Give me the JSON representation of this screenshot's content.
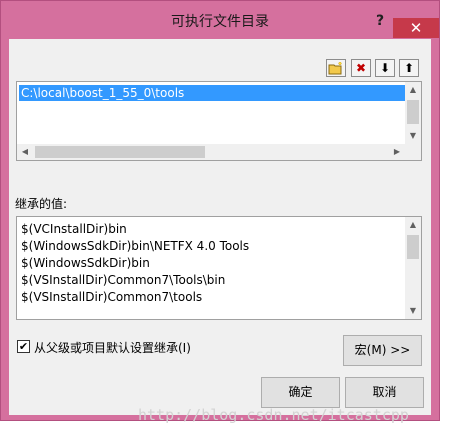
{
  "window": {
    "title": "可执行文件目录",
    "help_glyph": "?",
    "close_glyph": "✕"
  },
  "toolbar": {
    "new_line_icon": "new-folder-icon",
    "delete_glyph": "✖",
    "move_down_glyph": "⬇",
    "move_up_glyph": "⬆"
  },
  "directories": {
    "items": [
      "C:\\local\\boost_1_55_0\\tools"
    ],
    "selected_index": 0
  },
  "inherited": {
    "label": "继承的值:",
    "items": [
      "$(VCInstallDir)bin",
      "$(WindowsSdkDir)bin\\NETFX 4.0 Tools",
      "$(WindowsSdkDir)bin",
      "$(VSInstallDir)Common7\\Tools\\bin",
      "$(VSInstallDir)Common7\\tools"
    ]
  },
  "inherit_checkbox": {
    "label": "从父级或项目默认设置继承(I)",
    "checked": true,
    "check_glyph": "✔"
  },
  "buttons": {
    "macros": "宏(M) >>",
    "ok": "确定",
    "cancel": "取消"
  },
  "watermark": "http://blog.csdn.net/itcastcpp",
  "colors": {
    "frame": "#d5709e",
    "close": "#c6394a",
    "selection": "#3399ff",
    "delete": "#c00000"
  }
}
